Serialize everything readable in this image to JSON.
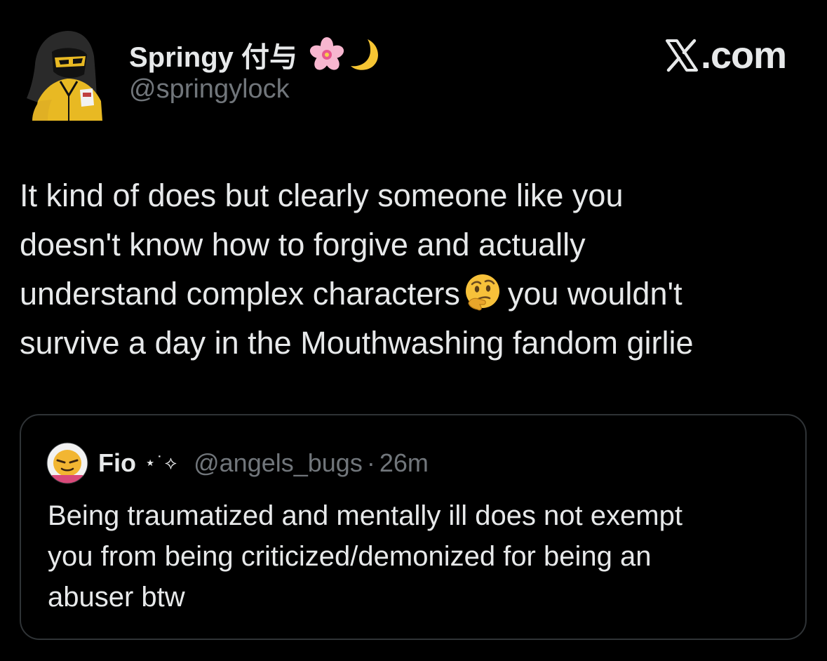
{
  "tweet": {
    "author": {
      "display_name": "Springy 付与",
      "name_decorations": [
        "cherry-blossom-emoji",
        "crescent-moon-emoji"
      ],
      "handle": "@springylock",
      "avatar_icon": "hooded-figure-avatar"
    },
    "brand": {
      "logo_icon": "x-logo-icon",
      "text": ".com"
    },
    "text_lines": [
      "It kind of does but clearly someone like you",
      "doesn't know how to forgive and actually",
      "understand complex characters",
      "you wouldn't",
      "survive a day in the Mouthwashing fandom girlie"
    ],
    "inline_emoji": "thinking-face-emoji"
  },
  "quote": {
    "author": {
      "display_name": "Fio",
      "sparkle": "⋆˙⟡",
      "handle": "@angels_bugs",
      "separator": "·",
      "time": "26m",
      "avatar_icon": "yellow-face-avatar"
    },
    "text_lines": [
      "Being traumatized and mentally ill does not exempt",
      "you from being criticized/demonized for being an",
      "abuser btw"
    ]
  },
  "colors": {
    "background": "#000000",
    "primary_text": "#e7e9ea",
    "secondary_text": "#71767b",
    "border": "#2f3336",
    "accent_yellow": "#e8b923"
  }
}
